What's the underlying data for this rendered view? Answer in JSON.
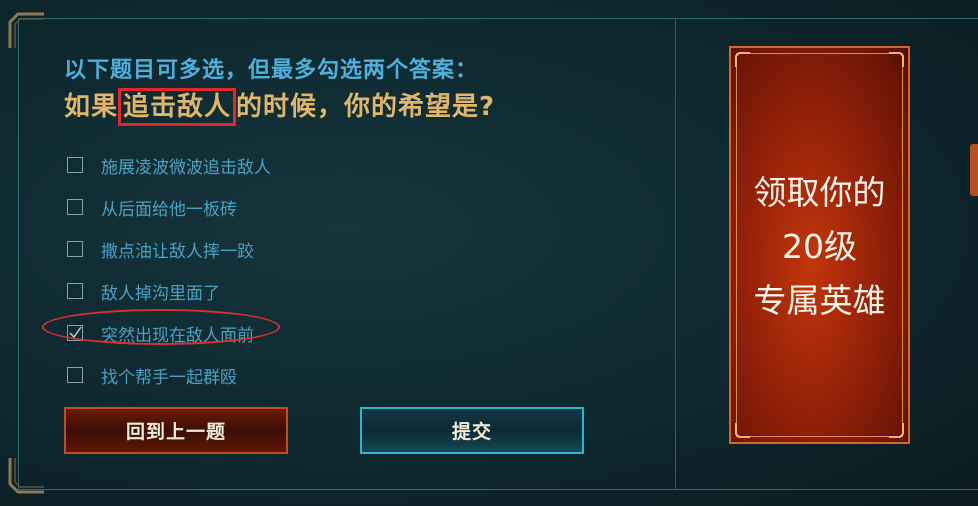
{
  "instruction": "以下题目可多选，但最多勾选两个答案：",
  "question": {
    "prefix": "如果",
    "highlight": "追击敌人",
    "suffix": "的时候，你的希望是?"
  },
  "options": [
    {
      "label": "施展凌波微波追击敌人",
      "checked": false
    },
    {
      "label": "从后面给他一板砖",
      "checked": false
    },
    {
      "label": "撒点油让敌人摔一跤",
      "checked": false
    },
    {
      "label": "敌人掉沟里面了",
      "checked": false
    },
    {
      "label": "突然出现在敌人面前",
      "checked": true
    },
    {
      "label": "找个帮手一起群殴",
      "checked": false
    }
  ],
  "buttons": {
    "back": "回到上一题",
    "submit": "提交"
  },
  "promo": {
    "line1": "领取你的",
    "line2": "20级",
    "line3": "专属英雄"
  },
  "colors": {
    "instruction": "#4fb0dc",
    "question": "#e0b66a",
    "highlight_border": "#e2262a",
    "option_text": "#4aa0c3",
    "back_button_border": "#c2501e",
    "submit_button_border": "#2fb5cf",
    "promo_bg": "#9c2408"
  },
  "icons": {
    "checked": "checkmark-icon",
    "frame_corner": "ornate-corner-icon"
  }
}
